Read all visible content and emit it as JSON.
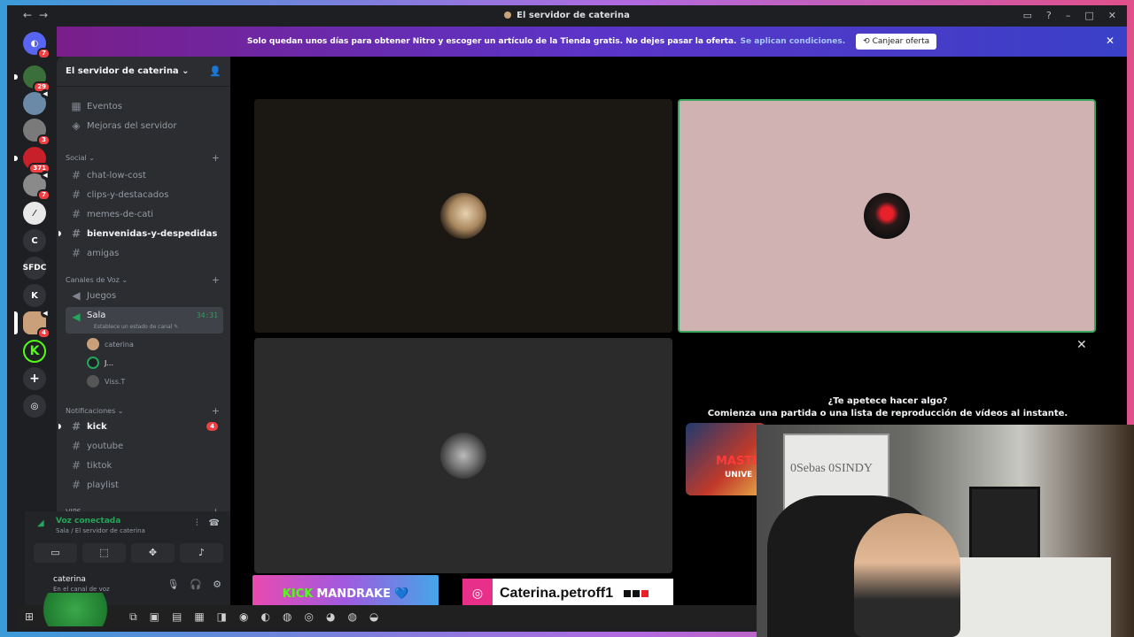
{
  "window": {
    "title": "El servidor de caterina",
    "controls": [
      "▭",
      "?",
      "–",
      "□",
      "✕"
    ]
  },
  "banner": {
    "text": "Solo quedan unos días para obtener Nitro y escoger un artículo de la Tienda gratis. No dejes pasar la oferta.",
    "link": "Se aplican condiciones.",
    "button": "Canjear oferta"
  },
  "rail": {
    "servers": [
      {
        "label": "",
        "badge": "7",
        "color": "#5865f2"
      },
      {
        "label": "",
        "badge": "29",
        "color": "#3a6e3a"
      },
      {
        "label": "",
        "badge": "",
        "color": "#6a8aa8"
      },
      {
        "label": "",
        "badge": "3",
        "color": "#7a7a7a"
      },
      {
        "label": "",
        "badge": "371",
        "color": "#c8202a"
      },
      {
        "label": "",
        "badge": "7",
        "color": "#8a8a8a"
      },
      {
        "label": "",
        "badge": "",
        "color": "#e8e8e8"
      },
      {
        "label": "C",
        "badge": "",
        "color": "#313338"
      },
      {
        "label": "SFDC",
        "badge": "",
        "color": "#313338"
      },
      {
        "label": "K",
        "badge": "",
        "color": "#313338"
      },
      {
        "label": "",
        "badge": "4",
        "color": "#c9a07a"
      },
      {
        "label": "K",
        "badge": "",
        "color": "#53fc18"
      },
      {
        "label": "+",
        "badge": "",
        "color": "#313338"
      },
      {
        "label": "◎",
        "badge": "",
        "color": "#313338"
      }
    ]
  },
  "sidebar": {
    "server_name": "El servidor de caterina",
    "top_items": [
      "Eventos",
      "Mejoras del servidor"
    ],
    "social_category": "Social",
    "social_channels": [
      "chat-low-cost",
      "clips-y-destacados",
      "memes-de-cati",
      "bienvenidas-y-despedidas",
      "amigas"
    ],
    "voice_category": "Canales de Voz",
    "voice_channels": [
      "Juegos",
      "Sala"
    ],
    "sala_timer": "34:31",
    "sala_status": "Establece un estado de canal",
    "voice_members": [
      "caterina",
      "J...",
      "Viss.T"
    ],
    "notif_category": "Notificaciones",
    "notif_channels": [
      "kick",
      "youtube",
      "tiktok",
      "playlist"
    ],
    "kick_badge": "4",
    "vips_category": "VIPS"
  },
  "voice_panel": {
    "title": "Voz conectada",
    "subtitle": "Sala / El servidor de caterina",
    "user": "caterina",
    "user_status": "En el canal de voz"
  },
  "stage": {
    "activity_title": "¿Te apetece hacer algo?",
    "activity_subtitle": "Comienza una partida o una lista de reproducción de vídeos al instante.",
    "game_label": "MASTERS",
    "game_sub": "UNIVE"
  },
  "cam": {
    "board_text": "0Sebas  0SINDY"
  },
  "overlays": {
    "kick_prefix": "KICK",
    "kick_name": "MANDRAKE",
    "kick_heart": "💙",
    "instagram_handle": "Caterina.petroff1"
  }
}
